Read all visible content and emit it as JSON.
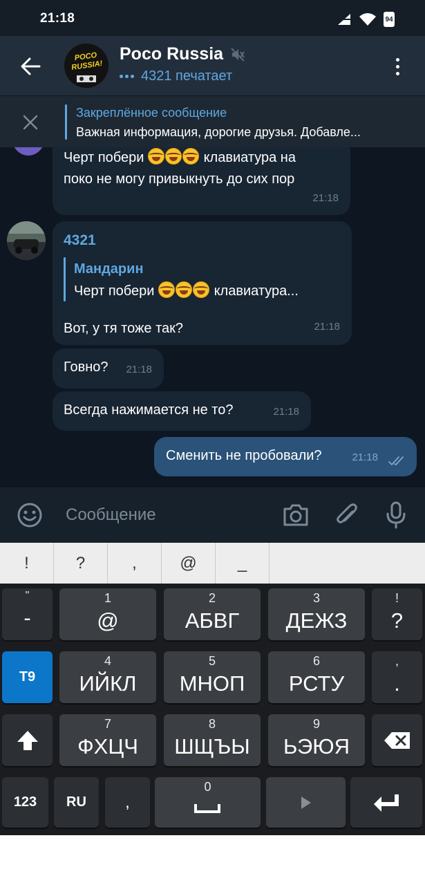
{
  "status_bar": {
    "time": "21:18",
    "battery": "94"
  },
  "header": {
    "title": "Poco Russia",
    "typing_status": "4321 печатает",
    "avatar_text_line1": "POCO",
    "avatar_text_line2": "RUSSIA!"
  },
  "pinned": {
    "title": "Закреплённое сообщение",
    "text": "Важная информация, дорогие друзья. Добавле..."
  },
  "messages": [
    {
      "text_a": "Черт  побери ",
      "text_b": " клавиатура на",
      "text_c": "поко не могу привыкнуть до сих пор",
      "time": "21:18"
    },
    {
      "sender": "4321",
      "reply_name": "Мандарин",
      "reply_text_a": "Черт  побери ",
      "reply_text_b": " клавиатура...",
      "text": "Вот, у тя тоже так?",
      "time": "21:18"
    },
    {
      "text": "Говно?",
      "time": "21:18"
    },
    {
      "text": "Всегда нажимается не то?",
      "time": "21:18"
    },
    {
      "text": "Сменить не пробовали?",
      "time": "21:18",
      "outgoing": true
    }
  ],
  "input": {
    "placeholder": "Сообщение"
  },
  "keyboard": {
    "suggestions": [
      "!",
      "?",
      ",",
      "@",
      "_"
    ],
    "rows": [
      [
        {
          "top": "\"",
          "label": "-"
        },
        {
          "top": "1",
          "label": "@"
        },
        {
          "top": "2",
          "label": "АБВГ"
        },
        {
          "top": "3",
          "label": "ДЕЖЗ"
        },
        {
          "top": "!",
          "label": "?"
        }
      ],
      [
        {
          "top": "",
          "label": "T9"
        },
        {
          "top": "4",
          "label": "ИЙКЛ"
        },
        {
          "top": "5",
          "label": "МНОП"
        },
        {
          "top": "6",
          "label": "РСТУ"
        },
        {
          "top": ",",
          "label": "."
        }
      ],
      [
        {
          "top": "",
          "label": "shift"
        },
        {
          "top": "7",
          "label": "ФХЦЧ"
        },
        {
          "top": "8",
          "label": "ШЩЪЫ"
        },
        {
          "top": "9",
          "label": "ЬЭЮЯ"
        },
        {
          "top": "",
          "label": "backspace"
        }
      ]
    ],
    "bottom": {
      "num_label": "123",
      "lang_label": "RU",
      "comma_label": ",",
      "space_top": "0"
    }
  },
  "colors": {
    "background": "#0e1621",
    "header": "#232e3c",
    "accent": "#5fa8e0",
    "incoming": "#182533",
    "outgoing": "#2b5278"
  }
}
